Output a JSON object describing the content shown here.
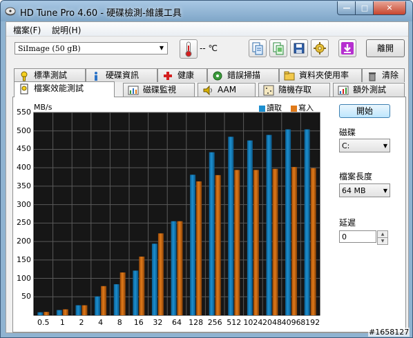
{
  "window": {
    "title": "HD Tune Pro 4.60 - 硬碟檢測-維護工具",
    "minimize_glyph": "—",
    "maximize_glyph": "□",
    "close_glyph": "✕"
  },
  "menu": {
    "file": "檔案(F)",
    "help": "說明(H)"
  },
  "toolbar": {
    "drive": "SiImage  (50 gB)",
    "temperature": "-- ℃",
    "exit_label": "離開",
    "icons": [
      "copy-text-icon",
      "copy-screenshot-icon",
      "save-icon",
      "options-icon",
      "download-icon"
    ]
  },
  "tabs_row1": [
    {
      "label": "標準測試",
      "icon": "benchmark-icon"
    },
    {
      "label": "硬碟資訊",
      "icon": "info-icon"
    },
    {
      "label": "健康",
      "icon": "health-icon"
    },
    {
      "label": "錯誤掃描",
      "icon": "error-scan-icon"
    },
    {
      "label": "資料夾使用率",
      "icon": "folder-usage-icon"
    },
    {
      "label": "清除",
      "icon": "erase-icon"
    }
  ],
  "tabs_row2": [
    {
      "label": "檔案效能測試",
      "icon": "file-benchmark-icon",
      "active": true
    },
    {
      "label": "磁碟監視",
      "icon": "disk-monitor-icon"
    },
    {
      "label": "AAM",
      "icon": "speaker-icon"
    },
    {
      "label": "隨機存取",
      "icon": "random-access-icon"
    },
    {
      "label": "額外測試",
      "icon": "extra-tests-icon"
    }
  ],
  "side": {
    "start_label": "開始",
    "drive_label": "磁碟",
    "drive_value": "C:",
    "file_length_label": "檔案長度",
    "file_length_value": "64 MB",
    "delay_label": "延遲",
    "delay_value": "0"
  },
  "colors": {
    "read": "#1c8fcf",
    "write": "#e07a1a",
    "plot_bg": "#161616",
    "grid": "#5a5a5a"
  },
  "watermark": "#1658127",
  "chart_data": {
    "type": "bar",
    "unit_label": "MB/s",
    "categories": [
      "0.5",
      "1",
      "2",
      "4",
      "8",
      "16",
      "32",
      "64",
      "128",
      "256",
      "512",
      "1024",
      "2048",
      "4096",
      "8192"
    ],
    "series": [
      {
        "name": "讀取",
        "values": [
          8,
          14,
          27,
          51,
          84,
          121,
          194,
          255,
          381,
          442,
          484,
          474,
          489,
          504,
          504
        ]
      },
      {
        "name": "寫入",
        "values": [
          9,
          16,
          27,
          79,
          116,
          159,
          222,
          255,
          363,
          380,
          394,
          394,
          397,
          402,
          399
        ]
      }
    ],
    "ylim": [
      0,
      550
    ],
    "yticks": [
      50,
      100,
      150,
      200,
      250,
      300,
      350,
      400,
      450,
      500,
      550
    ],
    "legend_position": "top-right",
    "grid": true
  }
}
